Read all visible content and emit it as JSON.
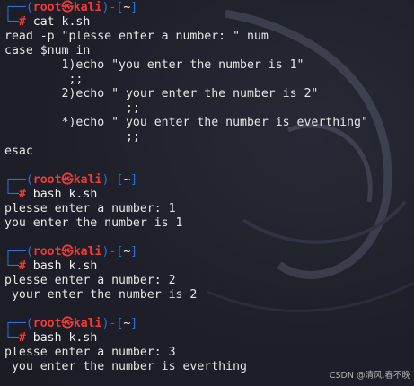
{
  "prompt": {
    "open": "┌──(",
    "user": "root",
    "skull": "㉿",
    "host": "kali",
    "mid": ")-[",
    "dir": "~",
    "close": "]",
    "second": "└─",
    "hash": "#"
  },
  "blocks": [
    {
      "command": "cat k.sh",
      "output": [
        "read -p \"plesse enter a number: \" num",
        "case $num in",
        "        1)echo \"you enter the number is 1\"",
        "         ;;",
        "        2)echo \" your enter the number is 2\"",
        "                 ;;",
        "        *)echo \" you enter the number is everthing\"",
        "                 ;;",
        "esac"
      ]
    },
    {
      "command": "bash k.sh",
      "output": [
        "plesse enter a number: 1",
        "you enter the number is 1"
      ]
    },
    {
      "command": "bash k.sh",
      "output": [
        "plesse enter a number: 2",
        " your enter the number is 2"
      ]
    },
    {
      "command": "bash k.sh",
      "output": [
        "plesse enter a number: 3",
        " you enter the number is everthing"
      ]
    }
  ],
  "watermark": "CSDN @清风.春不晚"
}
